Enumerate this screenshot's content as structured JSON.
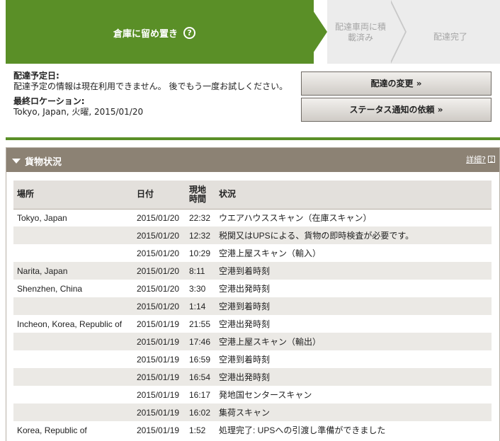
{
  "progress": {
    "active_step": "倉庫に留め置き",
    "help_icon": "?",
    "step2": "配達車両に積\n載済み",
    "step3": "配達完了"
  },
  "info": {
    "scheduled_label": "配達予定日:",
    "scheduled_text": "配達予定の情報は現在利用できません。 後でもう一度お試しください。",
    "last_location_label": "最終ロケーション:",
    "last_location_value": "Tokyo, Japan, 火曜, 2015/01/20",
    "change_delivery_button": "配達の変更 »",
    "status_notify_button": "ステータス通知の依頼 »"
  },
  "shipment": {
    "title": "貨物状況",
    "detail_link": "詳細?",
    "columns": [
      "場所",
      "日付",
      "現地時間",
      "状況"
    ],
    "rows": [
      {
        "location": "Tokyo, Japan",
        "date": "2015/01/20",
        "time": "22:32",
        "status": "ウエアハウススキャン（在庫スキャン）"
      },
      {
        "location": "",
        "date": "2015/01/20",
        "time": "12:32",
        "status": "税関又はUPSによる、貨物の即時検査が必要です。"
      },
      {
        "location": "",
        "date": "2015/01/20",
        "time": "10:29",
        "status": "空港上屋スキャン（輸入）"
      },
      {
        "location": "Narita, Japan",
        "date": "2015/01/20",
        "time": "8:11",
        "status": "空港到着時刻"
      },
      {
        "location": "Shenzhen, China",
        "date": "2015/01/20",
        "time": "3:30",
        "status": "空港出発時刻"
      },
      {
        "location": "",
        "date": "2015/01/20",
        "time": "1:14",
        "status": "空港到着時刻"
      },
      {
        "location": "Incheon, Korea, Republic of",
        "date": "2015/01/19",
        "time": "21:55",
        "status": "空港出発時刻"
      },
      {
        "location": "",
        "date": "2015/01/19",
        "time": "17:46",
        "status": "空港上屋スキャン（輸出）"
      },
      {
        "location": "",
        "date": "2015/01/19",
        "time": "16:59",
        "status": "空港到着時刻"
      },
      {
        "location": "",
        "date": "2015/01/19",
        "time": "16:54",
        "status": "空港出発時刻"
      },
      {
        "location": "",
        "date": "2015/01/19",
        "time": "16:17",
        "status": "発地国センタースキャン"
      },
      {
        "location": "",
        "date": "2015/01/19",
        "time": "16:02",
        "status": "集荷スキャン"
      },
      {
        "location": "Korea, Republic of",
        "date": "2015/01/19",
        "time": "1:52",
        "status": "処理完了: UPSへの引渡し準備ができました"
      }
    ]
  },
  "colors": {
    "accent_green": "#5a8f27",
    "panel_header": "#8c8274"
  }
}
